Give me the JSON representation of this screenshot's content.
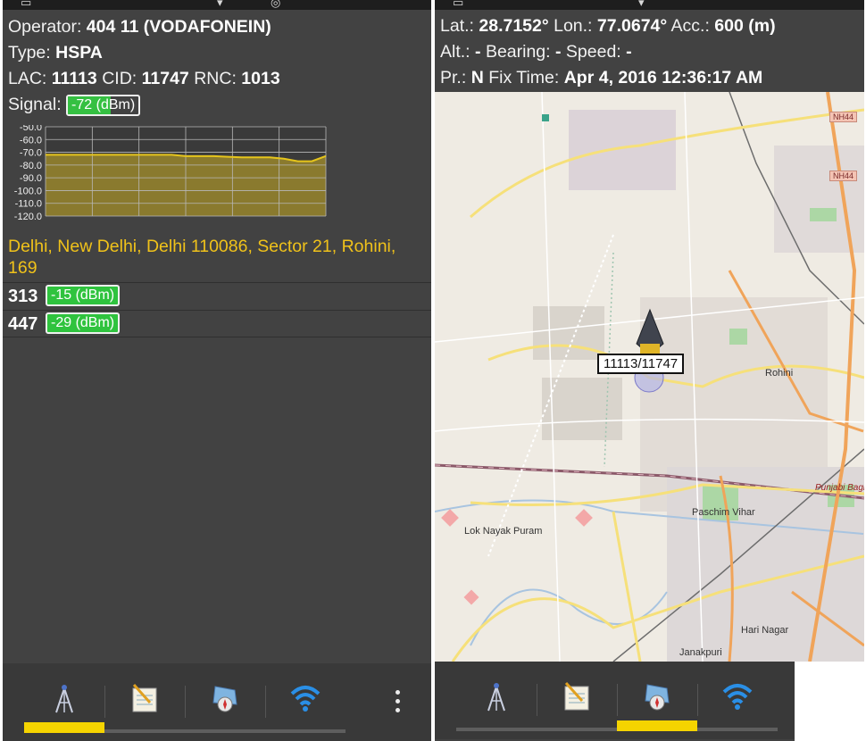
{
  "left": {
    "operator": {
      "label": "Operator:",
      "value": "404 11 (VODAFONEIN)"
    },
    "type": {
      "label": "Type:",
      "value": "HSPA"
    },
    "lac": {
      "label": "LAC:",
      "value": "11113"
    },
    "cid": {
      "label": "CID:",
      "value": "11747"
    },
    "rnc": {
      "label": "RNC:",
      "value": "1013"
    },
    "signal": {
      "label": "Signal:",
      "value": "-72 (dBm)",
      "fill_fraction": 0.6
    },
    "address": "Delhi, New Delhi, Delhi 110086, Sector 21, Rohini, 169",
    "neighbors": [
      {
        "id": "313",
        "signal": "-15 (dBm)"
      },
      {
        "id": "447",
        "signal": "-29 (dBm)"
      }
    ]
  },
  "chart_data": {
    "type": "area",
    "ytick_labels": [
      "-50.0",
      "-60.0",
      "-70.0",
      "-80.0",
      "-90.0",
      "-100.0",
      "-110.0",
      "-120.0"
    ],
    "ylim": [
      -120,
      -50
    ],
    "x": [
      0,
      1,
      2,
      3,
      4,
      5,
      6,
      7,
      8,
      9,
      10,
      11,
      12,
      13,
      14,
      15,
      16,
      17,
      18,
      19,
      20
    ],
    "values": [
      -72,
      -72,
      -72,
      -72,
      -72,
      -72,
      -72,
      -72,
      -72,
      -72,
      -73,
      -73,
      -73,
      -73.5,
      -74,
      -74,
      -74,
      -75,
      -77,
      -77,
      -73
    ],
    "series_color": "#e6c51c",
    "fill_color": "#8a7a2e",
    "grid": true
  },
  "right": {
    "lat": {
      "label": "Lat.:",
      "value": "28.7152°"
    },
    "lon": {
      "label": "Lon.:",
      "value": "77.0674°"
    },
    "acc": {
      "label": "Acc.:",
      "value": "600 (m)"
    },
    "alt": {
      "label": "Alt.:",
      "value": "-"
    },
    "bearing": {
      "label": "Bearing:",
      "value": "-"
    },
    "speed": {
      "label": "Speed:",
      "value": "-"
    },
    "provider": {
      "label": "Pr.:",
      "value": "N"
    },
    "fix_time": {
      "label": "Fix Time:",
      "value": "Apr 4, 2016 12:36:17 AM"
    },
    "map": {
      "cell_label": "11113/11747",
      "places": [
        "Rohini",
        "Punjabi Bagh",
        "Paschim Vihar",
        "Lok Nayak Puram",
        "Hari Nagar",
        "Janakpuri"
      ],
      "highway_shield_1": "NH44",
      "highway_shield_2": "NH44"
    }
  },
  "bottom_tabs": {
    "left_selected_index": 0,
    "right_selected_index": 2,
    "icons": [
      "cell-tower-icon",
      "log-notepad-icon",
      "map-compass-icon",
      "wifi-icon"
    ]
  },
  "colors": {
    "accent_yellow": "#f5d400",
    "signal_green": "#35c042",
    "address_yellow": "#f0c21a",
    "background": "#424242"
  }
}
